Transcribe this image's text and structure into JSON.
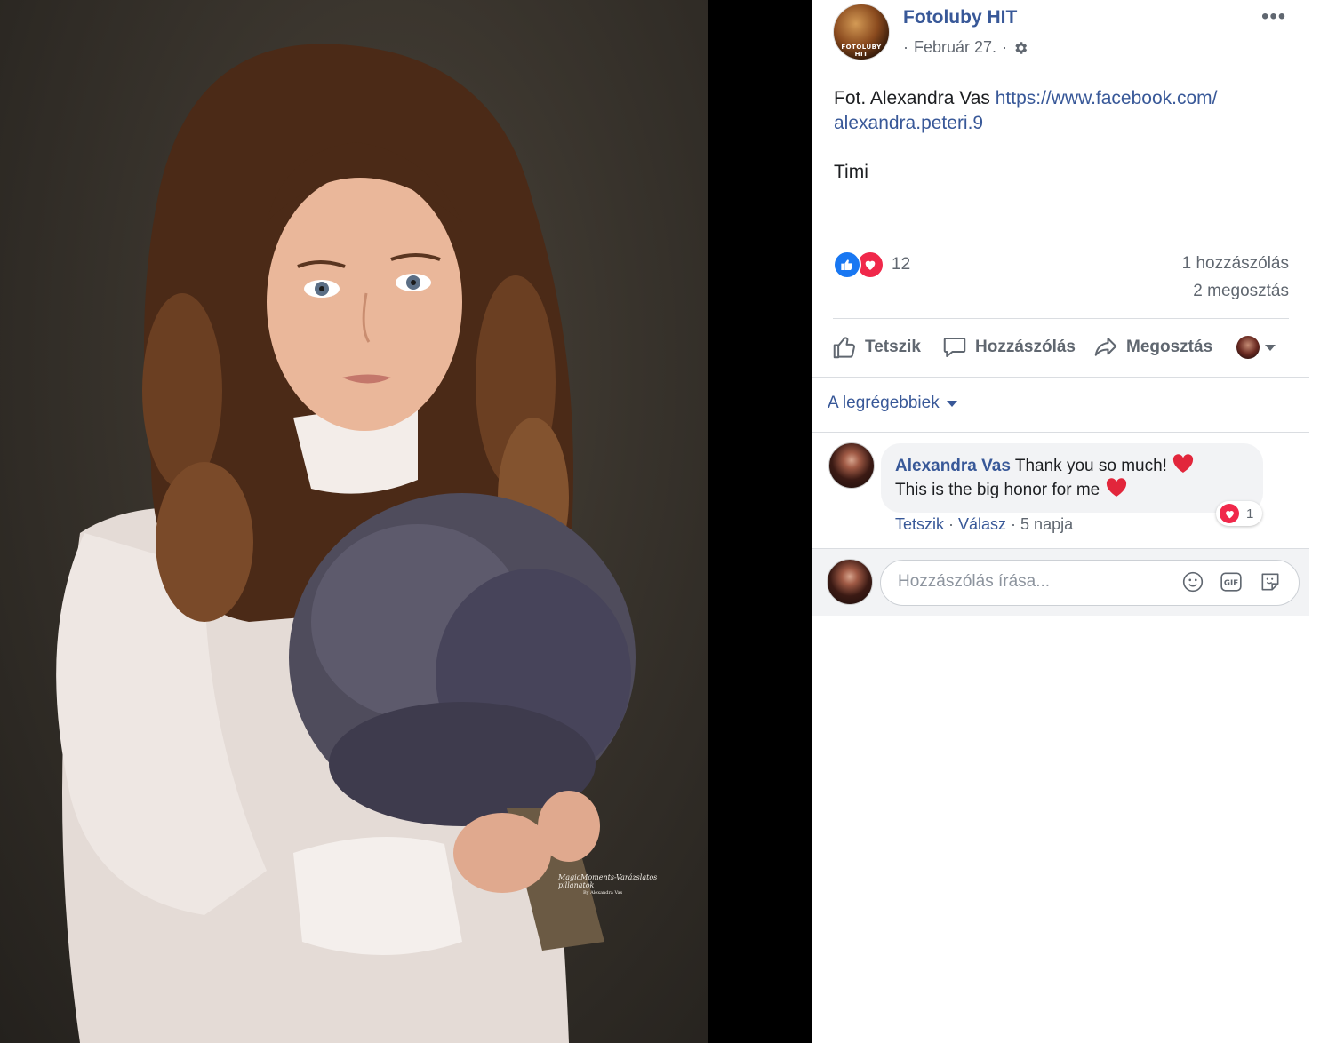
{
  "photo": {
    "watermark_line1": "MagicMoments-Varázslatos pillanatok",
    "watermark_line2": "By Alexandra Vas"
  },
  "post": {
    "page_logo_text": "FOTOLUBY HIT",
    "page_name": "Fotoluby HIT",
    "date": "Február 27.",
    "dot_1": "·",
    "dot_2": "·",
    "text_prefix": "Fot. Alexandra Vas ",
    "link_line1": "https://www.facebook.com/",
    "link_line2": "alexandra.peteri.9",
    "signature": "Timi",
    "more_label": "•••"
  },
  "stats": {
    "reaction_count": "12",
    "comment_count": "1 hozzászólás",
    "share_count": "2 megosztás"
  },
  "actions": {
    "like": "Tetszik",
    "comment": "Hozzászólás",
    "share": "Megosztás"
  },
  "sort": {
    "label": "A legrégebbiek"
  },
  "comment": {
    "author": "Alexandra Vas",
    "line1": "Thank you so much! ",
    "line2": "This is the big honor for me ",
    "reaction_count": "1",
    "like_label": "Tetszik",
    "sep1": " · ",
    "reply_label": "Válasz",
    "sep2": " · ",
    "time": "5 napja"
  },
  "composer": {
    "placeholder": "Hozzászólás írása..."
  },
  "colors": {
    "link_blue": "#385898",
    "like_blue": "#1877f2",
    "love_red": "#f0284a"
  }
}
